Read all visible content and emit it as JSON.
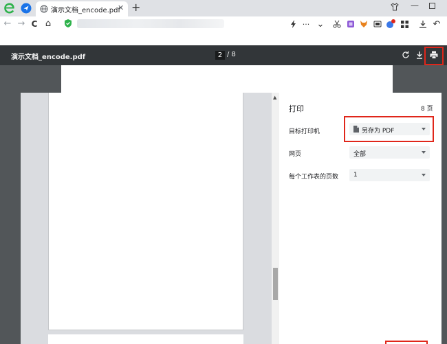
{
  "browser": {
    "tab_title": "演示文档_encode.pdf",
    "tab_close": "✕",
    "new_tab": "+",
    "window_min": "—",
    "nav_back": "←",
    "nav_forward": "→",
    "nav_reload": "C",
    "nav_home": "⌂",
    "more_dots": "···",
    "dropdown": "⌄",
    "undo": "↶"
  },
  "pdf_viewer": {
    "filename": "演示文档_encode.pdf",
    "current_page": "2",
    "total_pages": "/ 8"
  },
  "print_dialog": {
    "title": "打印",
    "page_count": "8 页",
    "destination_label": "目标打印机",
    "destination_value": "另存为 PDF",
    "pages_label": "网页",
    "pages_value": "全部",
    "pages_per_sheet_label": "每个工作表的页数",
    "pages_per_sheet_value": "1"
  },
  "colors": {
    "highlight": "#e0261a",
    "pdf_toolbar": "#323639",
    "viewer_background": "#525659",
    "brand_green": "#2eb24b"
  }
}
